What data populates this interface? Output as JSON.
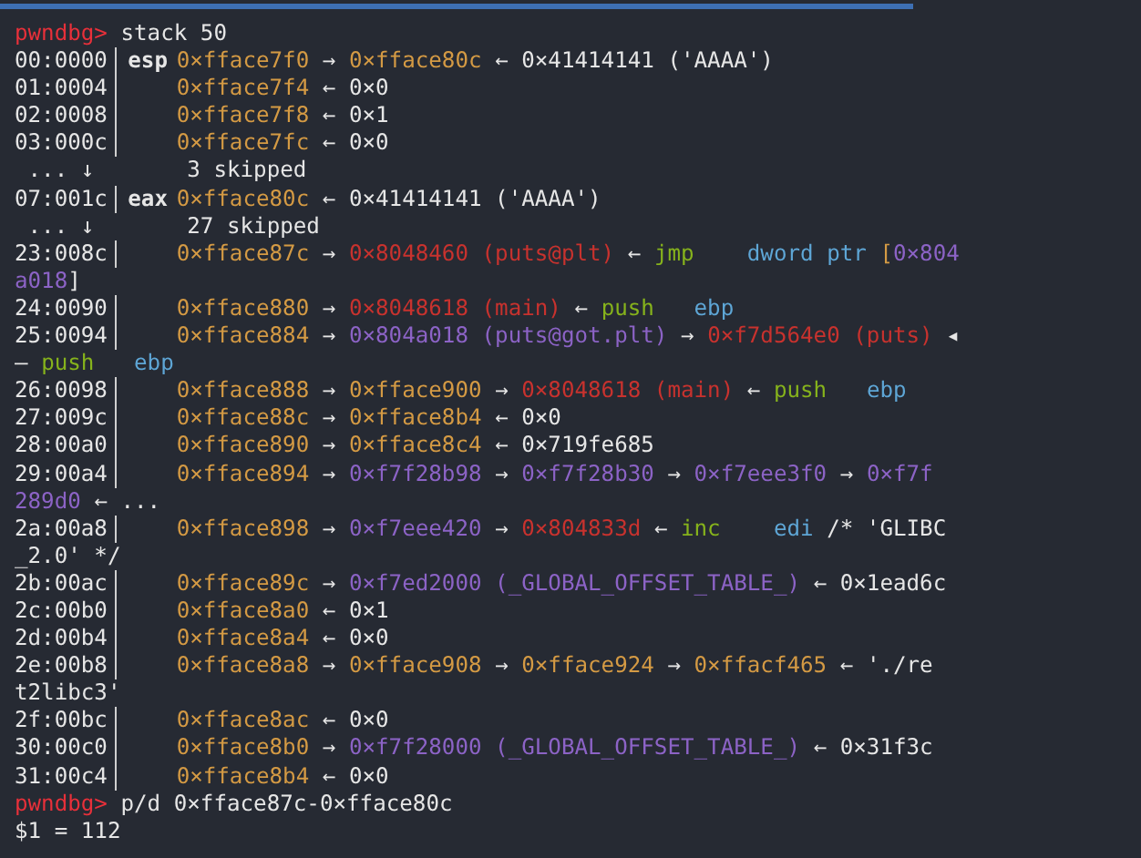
{
  "terminal": {
    "lines": [
      {
        "kind": "prompt",
        "prompt": "pwndbg>",
        "command": "stack 50"
      },
      {
        "kind": "stack",
        "offset": "00:0000",
        "register": "esp",
        "parts": [
          {
            "text": "0×fface7f0",
            "kind": "stack"
          },
          {
            "text": "→",
            "kind": "arrow"
          },
          {
            "text": "0×fface80c",
            "kind": "stack"
          },
          {
            "text": "←",
            "kind": "arrow"
          },
          {
            "text": "0×41414141 ('AAAA')",
            "kind": "plain"
          }
        ]
      },
      {
        "kind": "stack",
        "offset": "01:0004",
        "parts": [
          {
            "text": "0×fface7f4",
            "kind": "stack"
          },
          {
            "text": "←",
            "kind": "arrow"
          },
          {
            "text": "0×0",
            "kind": "plain"
          }
        ]
      },
      {
        "kind": "stack",
        "offset": "02:0008",
        "parts": [
          {
            "text": "0×fface7f8",
            "kind": "stack"
          },
          {
            "text": "←",
            "kind": "arrow"
          },
          {
            "text": "0×1",
            "kind": "plain"
          }
        ]
      },
      {
        "kind": "stack",
        "offset": "03:000c",
        "parts": [
          {
            "text": "0×fface7fc",
            "kind": "stack"
          },
          {
            "text": "←",
            "kind": "arrow"
          },
          {
            "text": "0×0",
            "kind": "plain"
          }
        ]
      },
      {
        "kind": "skip",
        "marker": "... ↓",
        "text": "3 skipped"
      },
      {
        "kind": "stack",
        "offset": "07:001c",
        "register": "eax",
        "parts": [
          {
            "text": "0×fface80c",
            "kind": "stack"
          },
          {
            "text": "←",
            "kind": "arrow"
          },
          {
            "text": "0×41414141 ('AAAA')",
            "kind": "plain"
          }
        ]
      },
      {
        "kind": "skip",
        "marker": "... ↓",
        "text": "27 skipped"
      },
      {
        "kind": "stack",
        "offset": "23:008c",
        "parts": [
          {
            "text": "0×fface87c",
            "kind": "stack"
          },
          {
            "text": "→",
            "kind": "arrow"
          },
          {
            "text": "0×8048460 (puts@plt)",
            "kind": "code"
          },
          {
            "text": "←",
            "kind": "arrow"
          },
          {
            "text": "jmp   ",
            "kind": "mnemonic"
          },
          {
            "text": "dword ptr",
            "kind": "operand"
          },
          {
            "text": "[",
            "kind": "stack"
          },
          {
            "text": "0×804",
            "kind": "data",
            "joined": true
          }
        ]
      },
      {
        "kind": "wrap",
        "parts": [
          {
            "text": "a018",
            "kind": "data"
          },
          {
            "text": "]",
            "kind": "plain",
            "joined": true
          }
        ]
      },
      {
        "kind": "stack",
        "offset": "24:0090",
        "parts": [
          {
            "text": "0×fface880",
            "kind": "stack"
          },
          {
            "text": "→",
            "kind": "arrow"
          },
          {
            "text": "0×8048618 (main)",
            "kind": "code"
          },
          {
            "text": "←",
            "kind": "arrow"
          },
          {
            "text": "push  ",
            "kind": "mnemonic"
          },
          {
            "text": "ebp",
            "kind": "operand"
          }
        ]
      },
      {
        "kind": "stack",
        "offset": "25:0094",
        "parts": [
          {
            "text": "0×fface884",
            "kind": "stack"
          },
          {
            "text": "→",
            "kind": "arrow"
          },
          {
            "text": "0×804a018 (puts@got.plt)",
            "kind": "data"
          },
          {
            "text": "→",
            "kind": "arrow"
          },
          {
            "text": "0×f7d564e0 (puts)",
            "kind": "code"
          },
          {
            "text": "◂",
            "kind": "arrow"
          }
        ]
      },
      {
        "kind": "wrap",
        "parts": [
          {
            "text": "—",
            "kind": "arrow"
          },
          {
            "text": "push  ",
            "kind": "mnemonic"
          },
          {
            "text": "ebp",
            "kind": "operand"
          }
        ]
      },
      {
        "kind": "stack",
        "offset": "26:0098",
        "parts": [
          {
            "text": "0×fface888",
            "kind": "stack"
          },
          {
            "text": "→",
            "kind": "arrow"
          },
          {
            "text": "0×fface900",
            "kind": "stack"
          },
          {
            "text": "→",
            "kind": "arrow"
          },
          {
            "text": "0×8048618 (main)",
            "kind": "code"
          },
          {
            "text": "←",
            "kind": "arrow"
          },
          {
            "text": "push  ",
            "kind": "mnemonic"
          },
          {
            "text": "ebp",
            "kind": "operand"
          }
        ]
      },
      {
        "kind": "stack",
        "offset": "27:009c",
        "parts": [
          {
            "text": "0×fface88c",
            "kind": "stack"
          },
          {
            "text": "→",
            "kind": "arrow"
          },
          {
            "text": "0×fface8b4",
            "kind": "stack"
          },
          {
            "text": "←",
            "kind": "arrow"
          },
          {
            "text": "0×0",
            "kind": "plain"
          }
        ]
      },
      {
        "kind": "stack",
        "offset": "28:00a0",
        "parts": [
          {
            "text": "0×fface890",
            "kind": "stack"
          },
          {
            "text": "→",
            "kind": "arrow"
          },
          {
            "text": "0×fface8c4",
            "kind": "stack"
          },
          {
            "text": "←",
            "kind": "arrow"
          },
          {
            "text": "0×719fe685",
            "kind": "plain"
          }
        ]
      },
      {
        "kind": "stack",
        "offset": "29:00a4",
        "parts": [
          {
            "text": "0×fface894",
            "kind": "stack"
          },
          {
            "text": "→",
            "kind": "arrow"
          },
          {
            "text": "0×f7f28b98",
            "kind": "data"
          },
          {
            "text": "→",
            "kind": "arrow"
          },
          {
            "text": "0×f7f28b30",
            "kind": "data"
          },
          {
            "text": "→",
            "kind": "arrow"
          },
          {
            "text": "0×f7eee3f0",
            "kind": "data"
          },
          {
            "text": "→",
            "kind": "arrow"
          },
          {
            "text": "0×f7f",
            "kind": "data"
          }
        ]
      },
      {
        "kind": "wrap",
        "parts": [
          {
            "text": "289d0",
            "kind": "data"
          },
          {
            "text": "←",
            "kind": "arrow"
          },
          {
            "text": "...",
            "kind": "plain"
          }
        ]
      },
      {
        "kind": "stack",
        "offset": "2a:00a8",
        "parts": [
          {
            "text": "0×fface898",
            "kind": "stack"
          },
          {
            "text": "→",
            "kind": "arrow"
          },
          {
            "text": "0×f7eee420",
            "kind": "data"
          },
          {
            "text": "→",
            "kind": "arrow"
          },
          {
            "text": "0×804833d",
            "kind": "code"
          },
          {
            "text": "←",
            "kind": "arrow"
          },
          {
            "text": "inc   ",
            "kind": "mnemonic"
          },
          {
            "text": "edi",
            "kind": "operand"
          },
          {
            "text": "/* 'GLIBC",
            "kind": "plain"
          }
        ]
      },
      {
        "kind": "wrap",
        "parts": [
          {
            "text": "_2.0' */",
            "kind": "plain"
          }
        ]
      },
      {
        "kind": "stack",
        "offset": "2b:00ac",
        "parts": [
          {
            "text": "0×fface89c",
            "kind": "stack"
          },
          {
            "text": "→",
            "kind": "arrow"
          },
          {
            "text": "0×f7ed2000 (_GLOBAL_OFFSET_TABLE_)",
            "kind": "data"
          },
          {
            "text": "←",
            "kind": "arrow"
          },
          {
            "text": "0×1ead6c",
            "kind": "plain"
          }
        ]
      },
      {
        "kind": "stack",
        "offset": "2c:00b0",
        "parts": [
          {
            "text": "0×fface8a0",
            "kind": "stack"
          },
          {
            "text": "←",
            "kind": "arrow"
          },
          {
            "text": "0×1",
            "kind": "plain"
          }
        ]
      },
      {
        "kind": "stack",
        "offset": "2d:00b4",
        "parts": [
          {
            "text": "0×fface8a4",
            "kind": "stack"
          },
          {
            "text": "←",
            "kind": "arrow"
          },
          {
            "text": "0×0",
            "kind": "plain"
          }
        ]
      },
      {
        "kind": "stack",
        "offset": "2e:00b8",
        "parts": [
          {
            "text": "0×fface8a8",
            "kind": "stack"
          },
          {
            "text": "→",
            "kind": "arrow"
          },
          {
            "text": "0×fface908",
            "kind": "stack"
          },
          {
            "text": "→",
            "kind": "arrow"
          },
          {
            "text": "0×fface924",
            "kind": "stack"
          },
          {
            "text": "→",
            "kind": "arrow"
          },
          {
            "text": "0×ffacf465",
            "kind": "stack"
          },
          {
            "text": "←",
            "kind": "arrow"
          },
          {
            "text": "'./re",
            "kind": "plain"
          }
        ]
      },
      {
        "kind": "wrap",
        "parts": [
          {
            "text": "t2libc3'",
            "kind": "plain"
          }
        ]
      },
      {
        "kind": "stack",
        "offset": "2f:00bc",
        "parts": [
          {
            "text": "0×fface8ac",
            "kind": "stack"
          },
          {
            "text": "←",
            "kind": "arrow"
          },
          {
            "text": "0×0",
            "kind": "plain"
          }
        ]
      },
      {
        "kind": "stack",
        "offset": "30:00c0",
        "parts": [
          {
            "text": "0×fface8b0",
            "kind": "stack"
          },
          {
            "text": "→",
            "kind": "arrow"
          },
          {
            "text": "0×f7f28000 (_GLOBAL_OFFSET_TABLE_)",
            "kind": "data"
          },
          {
            "text": "←",
            "kind": "arrow"
          },
          {
            "text": "0×31f3c",
            "kind": "plain"
          }
        ]
      },
      {
        "kind": "stack",
        "offset": "31:00c4",
        "parts": [
          {
            "text": "0×fface8b4",
            "kind": "stack"
          },
          {
            "text": "←",
            "kind": "arrow"
          },
          {
            "text": "0×0",
            "kind": "plain"
          }
        ]
      },
      {
        "kind": "prompt",
        "prompt": "pwndbg>",
        "command": "p/d 0×fface87c-0×fface80c"
      },
      {
        "kind": "output",
        "text": "$1 = 112"
      }
    ]
  }
}
